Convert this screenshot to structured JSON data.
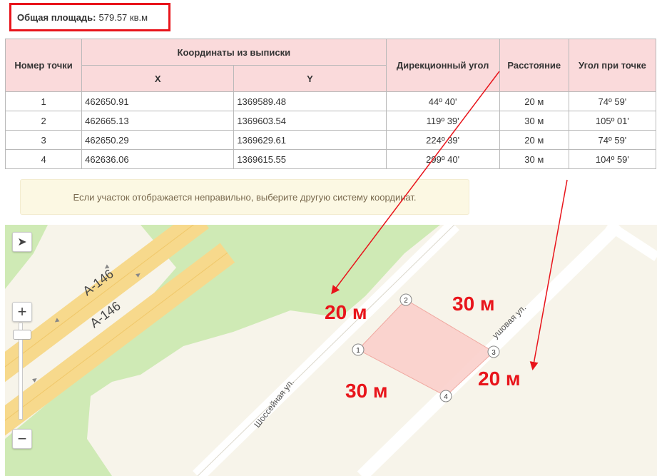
{
  "summary": {
    "area_label": "Общая площадь:",
    "area_value": "579.57 кв.м"
  },
  "table": {
    "headers": {
      "point_no": "Номер точки",
      "coords_group": "Координаты из выписки",
      "x": "X",
      "y": "Y",
      "direction": "Дирекционный угол",
      "distance": "Расстояние",
      "angle": "Угол при точке"
    },
    "rows": [
      {
        "no": "1",
        "x": "462650.91",
        "y": "1369589.48",
        "dir": "44º 40'",
        "dist": "20 м",
        "angle": "74º 59'"
      },
      {
        "no": "2",
        "x": "462665.13",
        "y": "1369603.54",
        "dir": "119º 39'",
        "dist": "30 м",
        "angle": "105º 01'"
      },
      {
        "no": "3",
        "x": "462650.29",
        "y": "1369629.61",
        "dir": "224º 39'",
        "dist": "20 м",
        "angle": "74º 59'"
      },
      {
        "no": "4",
        "x": "462636.06",
        "y": "1369615.55",
        "dir": "299º 40'",
        "dist": "30 м",
        "angle": "104º 59'"
      }
    ]
  },
  "notice": "Если участок отображается неправильно, выберите другую систему координат.",
  "map": {
    "road_a146_1": "А-146",
    "road_a146_2": "А-146",
    "street_shosseynaya": "Шоссейная ул.",
    "street_partial": "ушовая ул.",
    "vertices": [
      "1",
      "2",
      "3",
      "4"
    ],
    "annotations": {
      "left_20": "20 м",
      "top_30": "30 м",
      "right_20": "20 м",
      "bottom_30": "30 м"
    },
    "controls": {
      "locate": "locate-arrow-icon",
      "zoom_in": "+",
      "zoom_out": "−"
    },
    "colors": {
      "annotation": "#e8141b",
      "parcel_fill": "#f9cfcb",
      "road_major": "#f7d98c",
      "forest": "#cfeab5",
      "road_minor": "#ffffff"
    }
  }
}
